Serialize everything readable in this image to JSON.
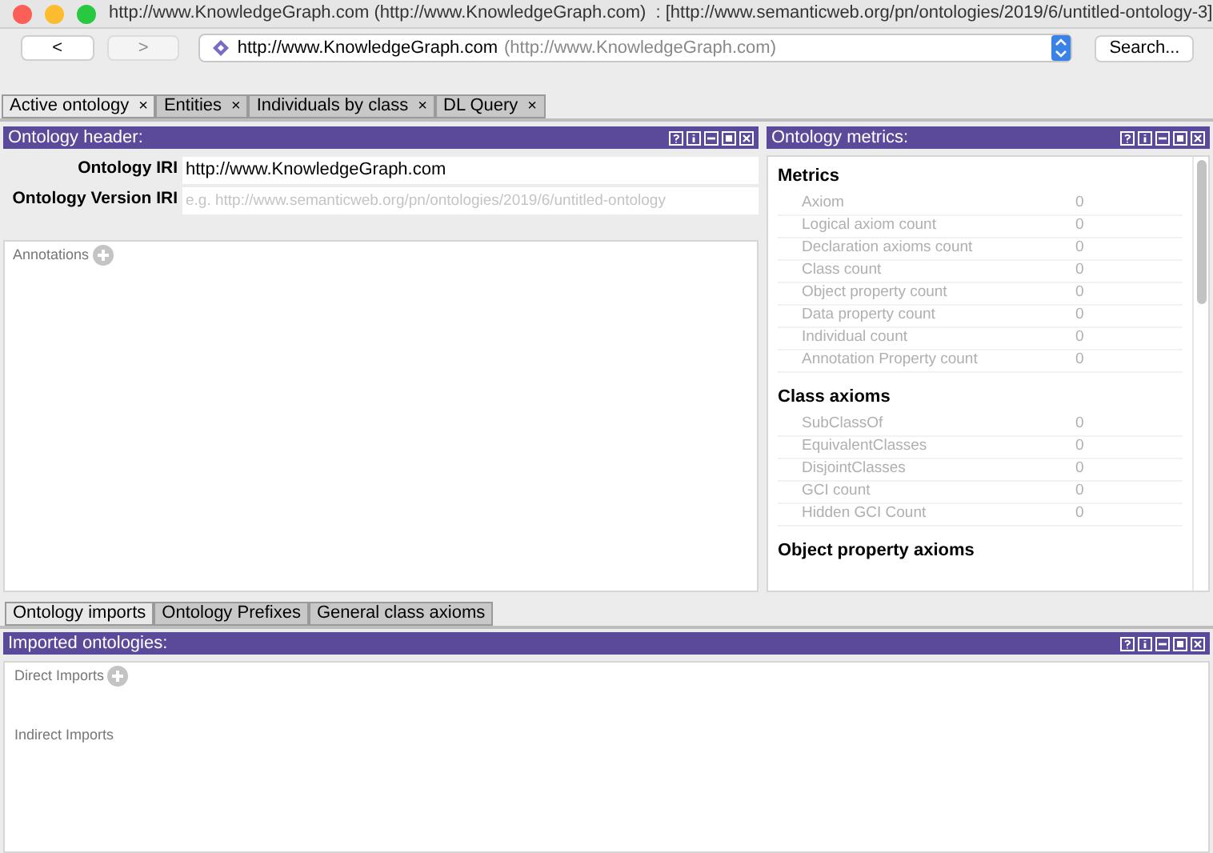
{
  "window": {
    "title": "http://www.KnowledgeGraph.com (http://www.KnowledgeGraph.com)  : [http://www.semanticweb.org/pn/ontologies/2019/6/untitled-ontology-3]"
  },
  "nav": {
    "back": "<",
    "forward": ">",
    "address": "http://www.KnowledgeGraph.com",
    "address_hint": "(http://www.KnowledgeGraph.com)",
    "search": "Search..."
  },
  "tabs": [
    {
      "label": "Active ontology",
      "close": "×",
      "selected": true
    },
    {
      "label": "Entities",
      "close": "×",
      "selected": false
    },
    {
      "label": "Individuals by class",
      "close": "×",
      "selected": false
    },
    {
      "label": "DL Query",
      "close": "×",
      "selected": false
    }
  ],
  "header_panel": {
    "title": "Ontology header:",
    "fields": [
      {
        "label": "Ontology IRI",
        "value": "http://www.KnowledgeGraph.com"
      },
      {
        "label": "Ontology Version IRI",
        "placeholder": "e.g. http://www.semanticweb.org/pn/ontologies/2019/6/untitled-ontology"
      }
    ],
    "annotations": "Annotations"
  },
  "metrics_panel": {
    "title": "Ontology metrics:",
    "sections": [
      {
        "heading": "Metrics",
        "rows": [
          {
            "name": "Axiom",
            "value": "0"
          },
          {
            "name": "Logical axiom count",
            "value": "0"
          },
          {
            "name": "Declaration axioms count",
            "value": "0"
          },
          {
            "name": "Class count",
            "value": "0"
          },
          {
            "name": "Object property count",
            "value": "0"
          },
          {
            "name": "Data property count",
            "value": "0"
          },
          {
            "name": "Individual count",
            "value": "0"
          },
          {
            "name": "Annotation Property count",
            "value": "0"
          }
        ]
      },
      {
        "heading": "Class axioms",
        "rows": [
          {
            "name": "SubClassOf",
            "value": "0"
          },
          {
            "name": "EquivalentClasses",
            "value": "0"
          },
          {
            "name": "DisjointClasses",
            "value": "0"
          },
          {
            "name": "GCI count",
            "value": "0"
          },
          {
            "name": "Hidden GCI Count",
            "value": "0"
          }
        ]
      },
      {
        "heading": "Object property axioms"
      }
    ]
  },
  "bottom_tabs": [
    {
      "label": "Ontology imports",
      "selected": true
    },
    {
      "label": "Ontology Prefixes",
      "selected": false
    },
    {
      "label": "General class axioms",
      "selected": false
    }
  ],
  "imports_panel": {
    "title": "Imported ontologies:",
    "direct": "Direct Imports",
    "indirect": "Indirect Imports"
  }
}
